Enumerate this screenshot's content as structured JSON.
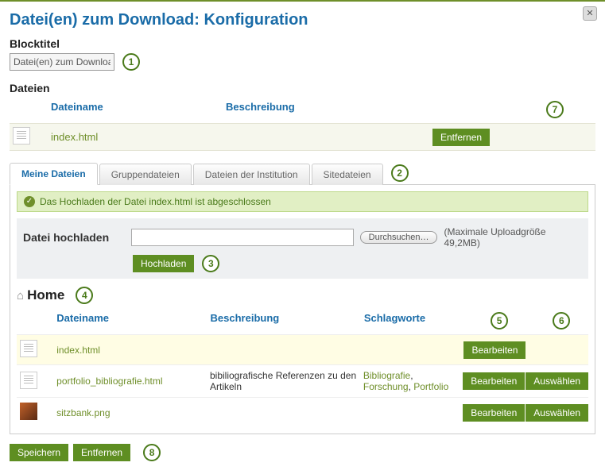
{
  "dialog": {
    "title": "Datei(en) zum Download: Konfiguration",
    "close_label": "✕"
  },
  "block_title": {
    "label": "Blocktitel",
    "value": "Datei(en) zum Downloa"
  },
  "selected_files": {
    "section_label": "Dateien",
    "columns": {
      "name": "Dateiname",
      "desc": "Beschreibung"
    },
    "rows": [
      {
        "name": "index.html",
        "remove_label": "Entfernen"
      }
    ]
  },
  "tabs": [
    {
      "id": "my",
      "label": "Meine Dateien",
      "active": true
    },
    {
      "id": "group",
      "label": "Gruppendateien",
      "active": false
    },
    {
      "id": "inst",
      "label": "Dateien der Institution",
      "active": false
    },
    {
      "id": "site",
      "label": "Sitedateien",
      "active": false
    }
  ],
  "message": "Das Hochladen der Datei index.html ist abgeschlossen",
  "upload": {
    "label": "Datei hochladen",
    "browse_label": "Durchsuchen…",
    "hint": "(Maximale Uploadgröße 49,2MB)",
    "submit_label": "Hochladen"
  },
  "breadcrumb": {
    "home": "Home"
  },
  "file_list": {
    "columns": {
      "name": "Dateiname",
      "desc": "Beschreibung",
      "tags": "Schlagworte"
    },
    "rows": [
      {
        "icon": "file",
        "name": "index.html",
        "desc": "",
        "tags": [],
        "edit_label": "Bearbeiten",
        "select_label": null,
        "highlight": true
      },
      {
        "icon": "file",
        "name": "portfolio_bibliografie.html",
        "desc": "bibiliografische Referenzen zu den Artikeln",
        "tags": [
          "Bibliografie",
          "Forschung",
          "Portfolio"
        ],
        "edit_label": "Bearbeiten",
        "select_label": "Auswählen",
        "highlight": false
      },
      {
        "icon": "image",
        "name": "sitzbank.png",
        "desc": "",
        "tags": [],
        "edit_label": "Bearbeiten",
        "select_label": "Auswählen",
        "highlight": false
      }
    ]
  },
  "footer": {
    "save_label": "Speichern",
    "remove_label": "Entfernen"
  },
  "annotations": {
    "a1": "1",
    "a2": "2",
    "a3": "3",
    "a4": "4",
    "a5": "5",
    "a6": "6",
    "a7": "7",
    "a8": "8"
  }
}
